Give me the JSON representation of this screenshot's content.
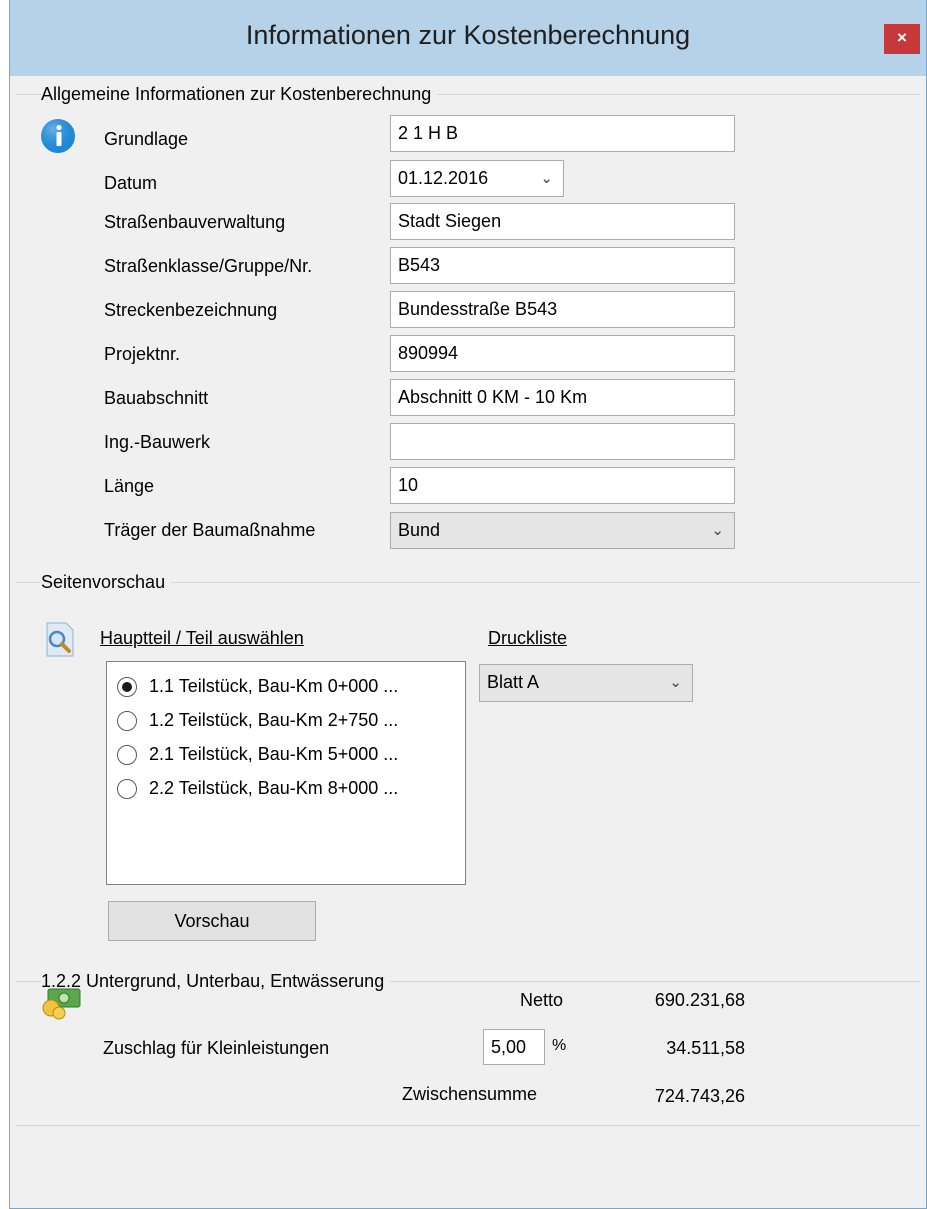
{
  "window": {
    "title": "Informationen zur Kostenberechnung",
    "close_label": "×"
  },
  "general": {
    "group_title": "Allgemeine Informationen zur Kostenberechnung",
    "fields": [
      {
        "label": "Grundlage",
        "value": "2 1 H B"
      },
      {
        "label": "Datum",
        "value": "01.12.2016"
      },
      {
        "label": "Straßenbauverwaltung",
        "value": "Stadt Siegen"
      },
      {
        "label": "Straßenklasse/Gruppe/Nr.",
        "value": "B543"
      },
      {
        "label": "Streckenbezeichnung",
        "value": "Bundesstraße B543"
      },
      {
        "label": "Projektnr.",
        "value": "890994"
      },
      {
        "label": "Bauabschnitt",
        "value": "Abschnitt 0 KM - 10 Km"
      },
      {
        "label": "Ing.-Bauwerk",
        "value": ""
      },
      {
        "label": "Länge",
        "value": "10"
      },
      {
        "label": "Träger der Baumaßnahme",
        "value": "Bund"
      }
    ],
    "info_icon": "info-icon"
  },
  "preview": {
    "group_title": "Seitenvorschau",
    "select_label": "Hauptteil / Teil auswählen",
    "print_list_label": "Druckliste",
    "print_list_value": "Blatt A",
    "options": [
      {
        "label": "1.1 Teilstück, Bau-Km 0+000 ...",
        "checked": true
      },
      {
        "label": "1.2 Teilstück, Bau-Km 2+750 ...",
        "checked": false
      },
      {
        "label": "2.1 Teilstück, Bau-Km 5+000 ...",
        "checked": false
      },
      {
        "label": "2.2 Teilstück, Bau-Km 8+000 ...",
        "checked": false
      }
    ],
    "preview_button": "Vorschau",
    "magnifier_icon": "magnifier-icon"
  },
  "costs": {
    "group_title": "1.2.2 Untergrund, Unterbau, Entwässerung",
    "netto_label": "Netto",
    "netto_value": "690.231,68",
    "surcharge_label": "Zuschlag für Kleinleistungen",
    "surcharge_percent": "5,00",
    "percent_sign": "%",
    "surcharge_value": "34.511,58",
    "subtotal_label": "Zwischensumme",
    "subtotal_value": "724.743,26",
    "money_icon": "money-icon"
  },
  "colors": {
    "titlebar": "#b5d2e8",
    "close": "#c7383a",
    "info": "#1e88d6"
  }
}
